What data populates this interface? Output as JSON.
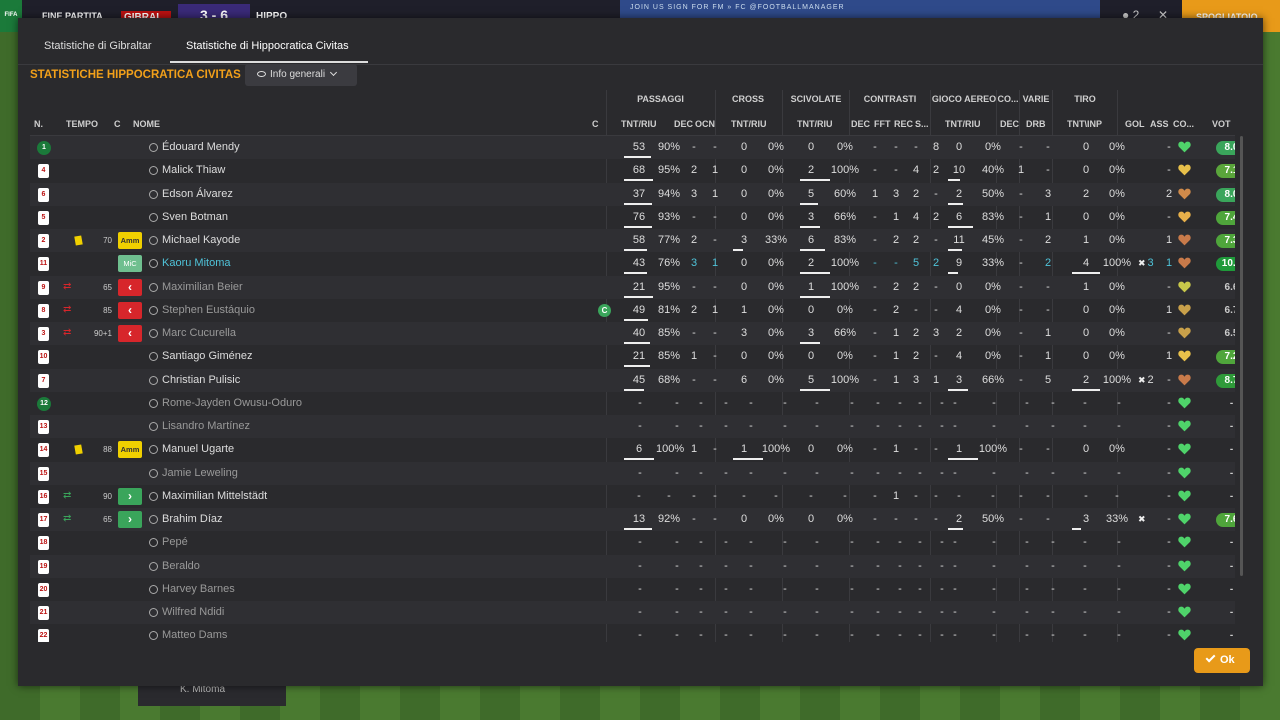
{
  "topbar": {
    "title": "FINE PARTITA",
    "team1": "GIBRAL",
    "score": "3 - 6",
    "team2": "HIPPO",
    "banner": "JOIN US    SIGN FOR FM » FC    @FOOTBALLMANAGER",
    "skip": "SPOGLIATOIO",
    "x": "✕",
    "dots": "● 2",
    "logo": "FIFA"
  },
  "tabs": [
    {
      "label": "Statistiche di Gibraltar"
    },
    {
      "label": "Statistiche di Hippocratica Civitas"
    }
  ],
  "section_title": "STATISTICHE HIPPOCRATICA CIVITAS",
  "info_dropdown": "Info generali",
  "groups": {
    "passaggi": "PASSAGGI",
    "cross": "CROSS",
    "scivolate": "SCIVOLATE",
    "contrasti": "CONTRASTI",
    "gioco": "GIOCO AEREO",
    "co": "CO...",
    "varie": "VARIE",
    "tiro": "TIRO"
  },
  "cols": {
    "n": "N.",
    "tempo": "TEMPO",
    "c": "C",
    "nome": "NOME",
    "c2": "C",
    "p_tnt": "TNT/RIU",
    "p_dec": "DEC",
    "p_ocn": "OCN",
    "cr_tnt": "TNT/RIU",
    "sc_tnt": "TNT/RIU",
    "ct_dec": "DEC",
    "ct_fft": "FFT",
    "ct_rec": "REC",
    "ct_s": "S...",
    "ga_tnt": "TNT/RIU",
    "co_dec": "DEC",
    "va_drb": "DRB",
    "ti_tnt": "TNT\\INP",
    "gol": "GOL",
    "ass": "ASS",
    "cond": "CO...",
    "vot": "VOT"
  },
  "rows": [
    {
      "num": "1",
      "gk": true,
      "name": "Édouard Mendy",
      "dim": false,
      "p": "53",
      "pp": "90%",
      "pdec": "-",
      "pocn": "-",
      "cr": "0",
      "crp": "0%",
      "sc": "0",
      "scp": "0%",
      "cdec": "-",
      "cfft": "-",
      "crec": "-",
      "cs": "8",
      "ga": "0",
      "gap": "0%",
      "codec": "-",
      "drb": "-",
      "ti": "0",
      "tip": "0%",
      "gol": "",
      "ass": "-",
      "heart": "#4fd36a",
      "vot": "8.0",
      "votc": "#3aa55b",
      "pbar": 0.9,
      "scbar": 0,
      "gabar": 0,
      "tibar": 0
    },
    {
      "num": "4",
      "name": "Malick Thiaw",
      "p": "68",
      "pp": "95%",
      "pdec": "2",
      "pocn": "1",
      "cr": "0",
      "crp": "0%",
      "sc": "2",
      "scp": "100%",
      "cdec": "-",
      "cfft": "-",
      "crec": "4",
      "cs": "2",
      "ga": "10",
      "gap": "40%",
      "codec": "1",
      "drb": "-",
      "ti": "0",
      "tip": "0%",
      "gol": "",
      "ass": "-",
      "heart": "#e8c04a",
      "vot": "7.1",
      "votc": "#5aa53b",
      "pbar": 0.95,
      "scbar": 1,
      "gabar": 0.4,
      "tibar": 0
    },
    {
      "num": "6",
      "name": "Edson Álvarez",
      "p": "37",
      "pp": "94%",
      "pdec": "3",
      "pocn": "1",
      "cr": "0",
      "crp": "0%",
      "sc": "5",
      "scp": "60%",
      "cdec": "1",
      "cfft": "3",
      "crec": "2",
      "cs": "-",
      "ga": "2",
      "gap": "50%",
      "codec": "-",
      "drb": "3",
      "ti": "2",
      "tip": "0%",
      "gol": "",
      "ass": "2",
      "heart": "#d08a4a",
      "vot": "8.0",
      "votc": "#3aa55b",
      "pbar": 0.94,
      "scbar": 0.6,
      "gabar": 0.5,
      "tibar": 0
    },
    {
      "num": "5",
      "name": "Sven Botman",
      "p": "76",
      "pp": "93%",
      "pdec": "-",
      "pocn": "-",
      "cr": "0",
      "crp": "0%",
      "sc": "3",
      "scp": "66%",
      "cdec": "-",
      "cfft": "1",
      "crec": "4",
      "cs": "2",
      "ga": "6",
      "gap": "83%",
      "codec": "-",
      "drb": "1",
      "ti": "0",
      "tip": "0%",
      "gol": "",
      "ass": "-",
      "heart": "#e8b04a",
      "vot": "7.4",
      "votc": "#4fa53b",
      "pbar": 0.93,
      "scbar": 0.66,
      "gabar": 0.83,
      "tibar": 0
    },
    {
      "num": "2",
      "card": "y",
      "min": "70",
      "role": "amm",
      "rolelabel": "Amm",
      "name": "Michael Kayode",
      "p": "58",
      "pp": "77%",
      "pdec": "2",
      "pocn": "-",
      "cr": "3",
      "crp": "33%",
      "sc": "6",
      "scp": "83%",
      "cdec": "-",
      "cfft": "2",
      "crec": "2",
      "cs": "-",
      "ga": "11",
      "gap": "45%",
      "codec": "-",
      "drb": "2",
      "ti": "1",
      "tip": "0%",
      "gol": "",
      "ass": "1",
      "heart": "#c87a4a",
      "vot": "7.3",
      "votc": "#4fa53b",
      "pbar": 0.77,
      "crbar": 0.33,
      "scbar": 0.83,
      "gabar": 0.45,
      "tibar": 0
    },
    {
      "num": "11",
      "role": "mic",
      "rolelabel": "MiC",
      "name": "Kaoru Mitoma",
      "sel": true,
      "p": "43",
      "pp": "76%",
      "pdec": "3",
      "pocn": "1",
      "cr": "0",
      "crp": "0%",
      "sc": "2",
      "scp": "100%",
      "cdec": "-",
      "cfft": "-",
      "crec": "5",
      "cs": "2",
      "ga": "9",
      "gap": "33%",
      "codec": "-",
      "drb": "2",
      "ti": "4",
      "tip": "100%",
      "gol": "3",
      "ass": "1",
      "heart": "#c87a4a",
      "vot": "10.0",
      "votc": "#1f9a3a",
      "pbar": 0.76,
      "scbar": 1,
      "gabar": 0.33,
      "tibar": 1
    },
    {
      "num": "9",
      "sub": "out",
      "min": "65",
      "role": "out",
      "name": "Maximilian Beier",
      "dim": true,
      "p": "21",
      "pp": "95%",
      "pdec": "-",
      "pocn": "-",
      "cr": "0",
      "crp": "0%",
      "sc": "1",
      "scp": "100%",
      "cdec": "-",
      "cfft": "2",
      "crec": "2",
      "cs": "-",
      "ga": "0",
      "gap": "0%",
      "codec": "-",
      "drb": "-",
      "ti": "1",
      "tip": "0%",
      "gol": "",
      "ass": "-",
      "heart": "#c8c84a",
      "vot": "6.6",
      "votc": "",
      "pbar": 0.95,
      "scbar": 1,
      "gabar": 0,
      "tibar": 0
    },
    {
      "num": "8",
      "sub": "out",
      "min": "85",
      "role": "out",
      "name": "Stephen Eustáquio",
      "dim": true,
      "cap": true,
      "p": "49",
      "pp": "81%",
      "pdec": "2",
      "pocn": "1",
      "cr": "1",
      "crp": "0%",
      "sc": "0",
      "scp": "0%",
      "cdec": "-",
      "cfft": "2",
      "crec": "-",
      "cs": "-",
      "ga": "4",
      "gap": "0%",
      "codec": "-",
      "drb": "-",
      "ti": "0",
      "tip": "0%",
      "gol": "",
      "ass": "1",
      "heart": "#c8a04a",
      "vot": "6.7",
      "votc": "",
      "pbar": 0.81,
      "scbar": 0,
      "gabar": 0,
      "tibar": 0
    },
    {
      "num": "3",
      "sub": "out",
      "min": "90+1",
      "role": "out",
      "name": "Marc Cucurella",
      "dim": true,
      "p": "40",
      "pp": "85%",
      "pdec": "-",
      "pocn": "-",
      "cr": "3",
      "crp": "0%",
      "sc": "3",
      "scp": "66%",
      "cdec": "-",
      "cfft": "1",
      "crec": "2",
      "cs": "3",
      "ga": "2",
      "gap": "0%",
      "codec": "-",
      "drb": "1",
      "ti": "0",
      "tip": "0%",
      "gol": "",
      "ass": "-",
      "heart": "#c8a04a",
      "vot": "6.5",
      "votc": "",
      "pbar": 0.85,
      "scbar": 0.66,
      "gabar": 0,
      "tibar": 0
    },
    {
      "num": "10",
      "name": "Santiago Giménez",
      "p": "21",
      "pp": "85%",
      "pdec": "1",
      "pocn": "-",
      "cr": "0",
      "crp": "0%",
      "sc": "0",
      "scp": "0%",
      "cdec": "-",
      "cfft": "1",
      "crec": "2",
      "cs": "-",
      "ga": "4",
      "gap": "0%",
      "codec": "-",
      "drb": "1",
      "ti": "0",
      "tip": "0%",
      "gol": "",
      "ass": "1",
      "heart": "#e8c04a",
      "vot": "7.2",
      "votc": "#4fa53b",
      "pbar": 0.85,
      "scbar": 0,
      "gabar": 0,
      "tibar": 0
    },
    {
      "num": "7",
      "name": "Christian Pulisic",
      "p": "45",
      "pp": "68%",
      "pdec": "-",
      "pocn": "-",
      "cr": "6",
      "crp": "0%",
      "sc": "5",
      "scp": "100%",
      "cdec": "-",
      "cfft": "1",
      "crec": "3",
      "cs": "1",
      "ga": "3",
      "gap": "66%",
      "codec": "-",
      "drb": "5",
      "ti": "2",
      "tip": "100%",
      "gol": "2",
      "ass": "-",
      "heart": "#c87a4a",
      "vot": "8.7",
      "votc": "#2f9a3a",
      "pbar": 0.68,
      "scbar": 1,
      "gabar": 0.66,
      "tibar": 1
    },
    {
      "num": "12",
      "gk": true,
      "name": "Rome-Jayden Owusu-Oduro",
      "dim": true,
      "empty": true,
      "heart": "#4fd36a"
    },
    {
      "num": "13",
      "name": "Lisandro Martínez",
      "dim": true,
      "empty": true,
      "heart": "#4fd36a"
    },
    {
      "num": "14",
      "card": "y",
      "min": "88",
      "role": "amm",
      "rolelabel": "Amm",
      "name": "Manuel Ugarte",
      "p": "6",
      "pp": "100%",
      "pdec": "1",
      "pocn": "-",
      "cr": "1",
      "crp": "100%",
      "sc": "0",
      "scp": "0%",
      "cdec": "-",
      "cfft": "1",
      "crec": "-",
      "cs": "-",
      "ga": "1",
      "gap": "100%",
      "codec": "-",
      "drb": "-",
      "ti": "0",
      "tip": "0%",
      "gol": "",
      "ass": "-",
      "heart": "#4fd36a",
      "vot": "-",
      "votc": "",
      "pbar": 1,
      "crbar": 1,
      "scbar": 0,
      "gabar": 1,
      "tibar": 0
    },
    {
      "num": "15",
      "name": "Jamie Leweling",
      "dim": true,
      "empty": true,
      "heart": "#4fd36a"
    },
    {
      "num": "16",
      "sub": "in",
      "min": "90",
      "role": "in",
      "name": "Maximilian Mittelstädt",
      "p": "-",
      "pp": "-",
      "pdec": "-",
      "pocn": "-",
      "cr": "-",
      "crp": "-",
      "sc": "-",
      "scp": "-",
      "cdec": "-",
      "cfft": "1",
      "crec": "-",
      "cs": "-",
      "ga": "-",
      "gap": "-",
      "codec": "-",
      "drb": "-",
      "ti": "-",
      "tip": "-",
      "gol": "",
      "ass": "-",
      "heart": "#4fd36a",
      "vot": "-",
      "votc": ""
    },
    {
      "num": "17",
      "sub": "in",
      "min": "65",
      "role": "in",
      "name": "Brahim Díaz",
      "p": "13",
      "pp": "92%",
      "pdec": "-",
      "pocn": "-",
      "cr": "0",
      "crp": "0%",
      "sc": "0",
      "scp": "0%",
      "cdec": "-",
      "cfft": "-",
      "crec": "-",
      "cs": "-",
      "ga": "2",
      "gap": "50%",
      "codec": "-",
      "drb": "-",
      "ti": "3",
      "tip": "33%",
      "gol": "1",
      "ass": "-",
      "heart": "#4fd36a",
      "vot": "7.6",
      "votc": "#4fa53b",
      "pbar": 0.92,
      "scbar": 0,
      "gabar": 0.5,
      "tibar": 0.33
    },
    {
      "num": "18",
      "name": "Pepé",
      "dim": true,
      "empty": true,
      "heart": "#4fd36a"
    },
    {
      "num": "19",
      "name": "Beraldo",
      "dim": true,
      "empty": true,
      "heart": "#4fd36a"
    },
    {
      "num": "20",
      "name": "Harvey Barnes",
      "dim": true,
      "empty": true,
      "heart": "#4fd36a"
    },
    {
      "num": "21",
      "name": "Wilfred Ndidi",
      "dim": true,
      "empty": true,
      "heart": "#4fd36a"
    },
    {
      "num": "22",
      "name": "Matteo Dams",
      "dim": true,
      "empty": true,
      "heart": "#4fd36a"
    }
  ],
  "ok_label": "Ok",
  "bottom_name": "K. Mitoma"
}
